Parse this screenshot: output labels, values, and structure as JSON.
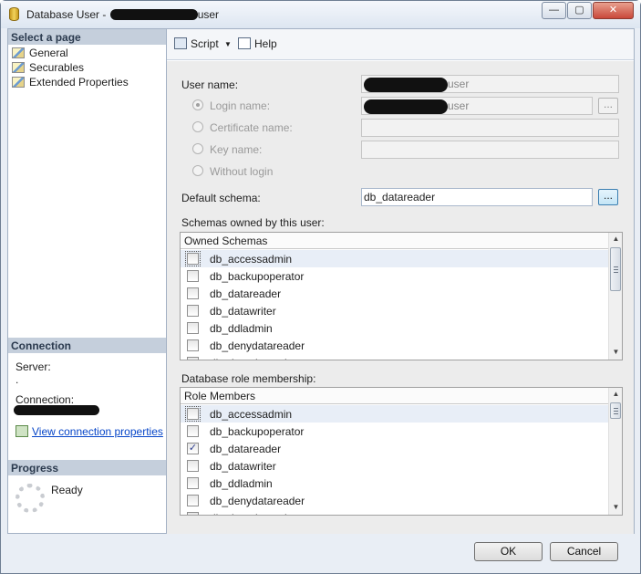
{
  "window": {
    "title_prefix": "Database User - ",
    "title_suffix": "user",
    "minimize_glyph": "—",
    "restore_glyph": "▢",
    "close_glyph": "✕"
  },
  "sidebar": {
    "select_header": "Select a page",
    "pages": [
      {
        "label": "General",
        "icon": "wrench-page-icon"
      },
      {
        "label": "Securables",
        "icon": "wrench-page-icon"
      },
      {
        "label": "Extended Properties",
        "icon": "wrench-page-icon"
      }
    ],
    "connection_header": "Connection",
    "server_label": "Server:",
    "server_value": ".",
    "connection_label": "Connection:",
    "view_connection_link": "View connection properties",
    "progress_header": "Progress",
    "progress_status": "Ready"
  },
  "toolbar": {
    "script_label": "Script",
    "script_dropdown_glyph": "▼",
    "help_label": "Help"
  },
  "form": {
    "user_name_label": "User name:",
    "user_name_suffix": "user",
    "login_name_label": "Login name:",
    "login_name_suffix": "user",
    "certificate_name_label": "Certificate name:",
    "key_name_label": "Key name:",
    "without_login_label": "Without login",
    "browse_glyph": "...",
    "default_schema_label": "Default schema:",
    "default_schema_value": "db_datareader",
    "schemas_owned_label": "Schemas owned by this user:",
    "owned_schemas_header": "Owned Schemas",
    "owned_schemas": [
      {
        "name": "db_accessadmin",
        "checked": false
      },
      {
        "name": "db_backupoperator",
        "checked": false
      },
      {
        "name": "db_datareader",
        "checked": false
      },
      {
        "name": "db_datawriter",
        "checked": false
      },
      {
        "name": "db_ddladmin",
        "checked": false
      },
      {
        "name": "db_denydatareader",
        "checked": false
      },
      {
        "name": "db_denydatawriter",
        "checked": false
      }
    ],
    "role_membership_label": "Database role membership:",
    "role_members_header": "Role Members",
    "role_members": [
      {
        "name": "db_accessadmin",
        "checked": false
      },
      {
        "name": "db_backupoperator",
        "checked": false
      },
      {
        "name": "db_datareader",
        "checked": true
      },
      {
        "name": "db_datawriter",
        "checked": false
      },
      {
        "name": "db_ddladmin",
        "checked": false
      },
      {
        "name": "db_denydatareader",
        "checked": false
      },
      {
        "name": "db_denydatawriter",
        "checked": false
      }
    ],
    "check_glyph": "✓",
    "scroll_up_glyph": "▲",
    "scroll_down_glyph": "▼"
  },
  "buttons": {
    "ok_label": "OK",
    "cancel_label": "Cancel"
  }
}
